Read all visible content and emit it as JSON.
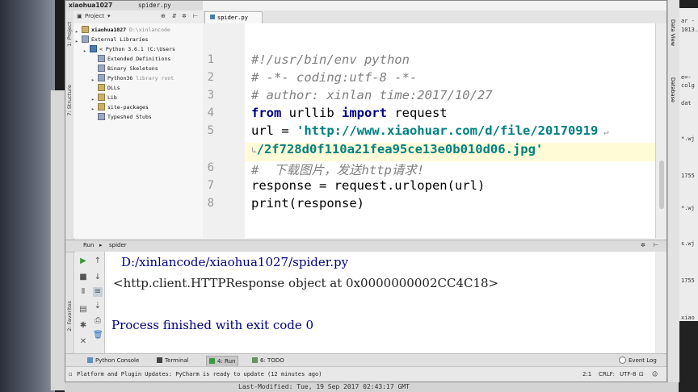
{
  "window": {
    "project_name": "xiaohua1027",
    "file_tab": "spider.py"
  },
  "project_panel": {
    "selector_label": "Project",
    "side_tabs": [
      "1: Project",
      "7: Structure",
      "2: Favorites"
    ],
    "tree": [
      {
        "label": "xiaohua1027",
        "extra": "D:\\xinlancode",
        "level": 0,
        "icon": "folder"
      },
      {
        "label": "External Libraries",
        "extra": "",
        "level": 0,
        "icon": "lib"
      },
      {
        "label": "< Python 3.6.1 (C:\\Users",
        "extra": "",
        "level": 1,
        "icon": "py"
      },
      {
        "label": "Extended Definitions",
        "extra": "",
        "level": 2,
        "icon": "lib"
      },
      {
        "label": "Binary Skeletons",
        "extra": "",
        "level": 2,
        "icon": "lib"
      },
      {
        "label": "Python36",
        "extra": "library root",
        "level": 2,
        "icon": "lib"
      },
      {
        "label": "DLLs",
        "extra": "",
        "level": 2,
        "icon": "folder"
      },
      {
        "label": "Lib",
        "extra": "",
        "level": 2,
        "icon": "folder"
      },
      {
        "label": "site-packages",
        "extra": "",
        "level": 2,
        "icon": "folder"
      },
      {
        "label": "Typeshed Stubs",
        "extra": "",
        "level": 2,
        "icon": "lib"
      }
    ]
  },
  "editor": {
    "tab_label": "spider.py",
    "line_numbers": [
      "1",
      "2",
      "3",
      "4",
      "5",
      "",
      "6",
      "7",
      "8"
    ],
    "lines": [
      "#!/usr/bin/env python",
      "# -*- coding:utf-8 -*-",
      "# author: xinlan time:2017/10/27",
      [
        "from",
        " urllib ",
        "import",
        " request"
      ],
      [
        "url = ",
        "'http://www.xiaohuar.com/d/file/20170919"
      ],
      [
        "/2f728d0f110a21fea95ce13e0b010d06.jpg'"
      ],
      "#  下载图片，发送http请求!",
      "response = request.urlopen(url)",
      "print(response)"
    ]
  },
  "run_panel": {
    "header_label": "Run",
    "config_name": "spider",
    "output": [
      "D:/xinlancode/xiaohua1027/spider.py",
      "<http.client.HTTPResponse object at 0x0000000002CC4C18>",
      "",
      "Process finished with exit code 0"
    ]
  },
  "bottom_tabs": [
    "Python Console",
    "Terminal",
    "4: Run",
    "6: TODO"
  ],
  "event_log": "Event Log",
  "status": {
    "message": "Platform and Plugin Updates: PyCharm is ready to update  (12 minutes ago)",
    "position": "2:1",
    "line_sep": "CRLF:",
    "encoding": "UTF-8"
  },
  "right_tool_tabs": [
    "Data View",
    "Database"
  ],
  "background_text": {
    "right_fragments": [
      "ar -",
      "1013.",
      "e=-",
      "colg",
      "dat",
      "*.wj",
      "1755",
      "*.wj",
      "s.wj",
      "1755",
      "xiao"
    ],
    "bottom_fragment": "Last-Modified: Tue, 19 Sep 2017 02:43:17 GMT"
  },
  "colors": {
    "keyword": "#000080",
    "string": "#008080",
    "comment": "#808080",
    "output_path": "#000080",
    "output_text": "#222222",
    "run_green": "#3a9a3a",
    "current_line": "#fffbd7"
  }
}
